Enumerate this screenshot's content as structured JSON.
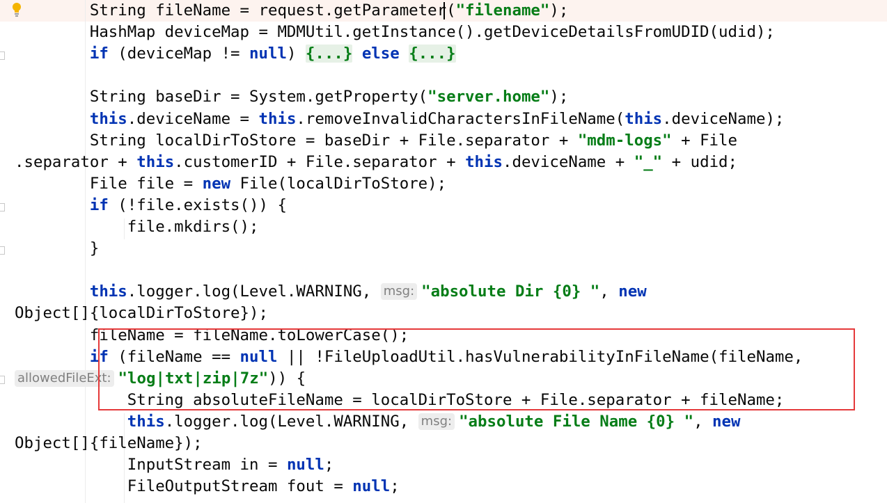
{
  "lines": [
    "        String fileName = request.getParameter(\"filename\");",
    "        HashMap deviceMap = MDMUtil.getInstance().getDeviceDetailsFromUDID(udid);",
    "        if (deviceMap != null) {...} else {...}",
    "",
    "        String baseDir = System.getProperty(\"server.home\");",
    "        this.deviceName = this.removeInvalidCharactersInFileName(this.deviceName);",
    "        String localDirToStore = baseDir + File.separator + \"mdm-logs\" + File",
    ".separator + this.customerID + File.separator + this.deviceName + \"_\" + udid;",
    "        File file = new File(localDirToStore);",
    "        if (!file.exists()) {",
    "            file.mkdirs();",
    "        }",
    "",
    "        this.logger.log(Level.WARNING, msg: \"absolute Dir {0} \", new",
    "Object[]{localDirToStore});",
    "        fileName = fileName.toLowerCase();",
    "        if (fileName == null || !FileUploadUtil.hasVulnerabilityInFileName(fileName,",
    "allowedFileExt: \"log|txt|zip|7z\")) {",
    "            String absoluteFileName = localDirToStore + File.separator + fileName;",
    "            this.logger.log(Level.WARNING, msg: \"absolute File Name {0} \", new",
    "Object[]{fileName});",
    "            InputStream in = null;",
    "            FileOutputStream fout = null;"
  ],
  "hints": {
    "msg": "msg:",
    "allowed_ext": "allowedFileExt:"
  },
  "colors": {
    "keyword": "#0033b3",
    "string": "#067d17",
    "highlight_box": "#e5393a",
    "current_line": "#fdf3ef"
  },
  "icons": {
    "gutter": "lightbulb-icon"
  }
}
